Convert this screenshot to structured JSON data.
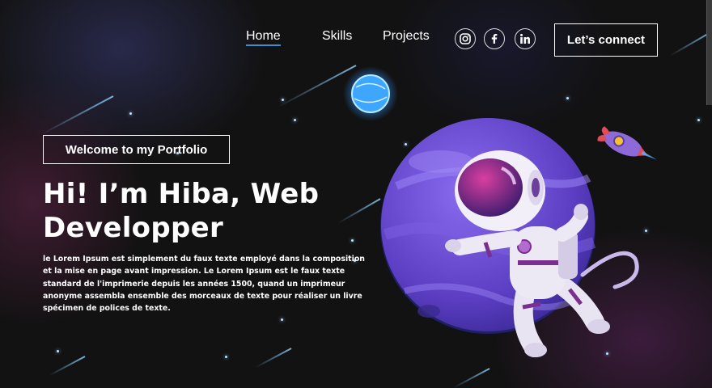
{
  "nav": {
    "links": [
      {
        "label": "Home",
        "active": true
      },
      {
        "label": "Skills",
        "active": false
      },
      {
        "label": "Projects",
        "active": false
      }
    ]
  },
  "social": [
    {
      "icon": "instagram-icon"
    },
    {
      "icon": "facebook-icon"
    },
    {
      "icon": "linkedin-icon"
    }
  ],
  "connect_label": "Let’s connect",
  "hero": {
    "badge": "Welcome to my Portfolio",
    "title_line1": "Hi! I’m Hiba, Web",
    "title_line2": "Developper",
    "text": "le Lorem Ipsum est simplement du faux texte employé dans la composition et la mise en page avant impression. Le Lorem Ipsum est le faux texte standard de l'imprimerie depuis les années 1500, quand un imprimeur anonyme assembla ensemble des morceaux de texte pour réaliser un livre spécimen de polices de texte."
  },
  "colors": {
    "background": "#121212",
    "accent_underline": "#3d8ecf",
    "planet": "#6a4fd0",
    "astronaut_accent": "#7a2f8f"
  }
}
